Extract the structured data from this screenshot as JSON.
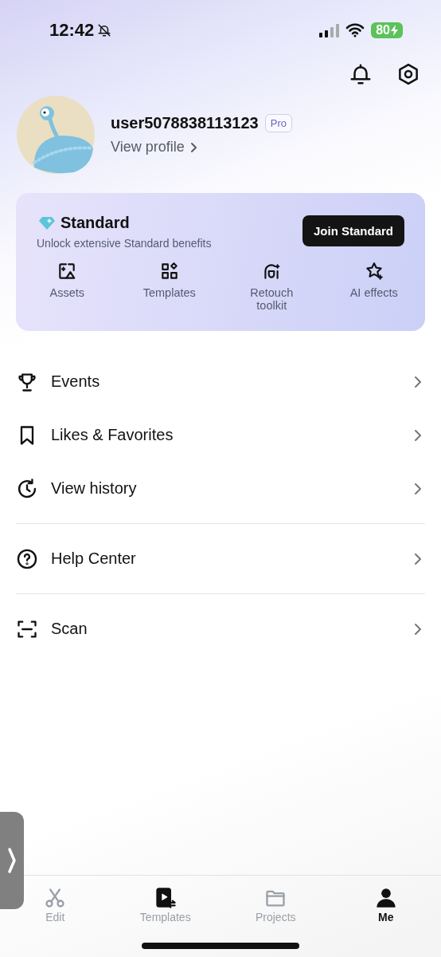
{
  "status_bar": {
    "time": "12:42",
    "silent": true,
    "battery": "80",
    "charging": true
  },
  "header_actions": [
    {
      "kind": "bell"
    },
    {
      "kind": "settings"
    }
  ],
  "profile": {
    "username": "user5078838113123",
    "badge": "Pro",
    "link": "View profile"
  },
  "membership": {
    "title": "Standard",
    "subtitle": "Unlock extensive Standard benefits",
    "button": "Join Standard",
    "benefits": [
      {
        "kind": "assets",
        "label": "Assets"
      },
      {
        "kind": "templates",
        "label": "Templates"
      },
      {
        "kind": "retouch",
        "label": "Retouch toolkit"
      },
      {
        "kind": "ai",
        "label": "AI effects"
      }
    ]
  },
  "menu_groups": [
    [
      {
        "kind": "trophy",
        "label": "Events"
      },
      {
        "kind": "bookmark",
        "label": "Likes & Favorites"
      },
      {
        "kind": "history",
        "label": "View history"
      }
    ],
    [
      {
        "kind": "help",
        "label": "Help Center"
      }
    ],
    [
      {
        "kind": "scan",
        "label": "Scan"
      }
    ]
  ],
  "tab_bar": [
    {
      "kind": "edit",
      "label": "Edit",
      "selected": false
    },
    {
      "kind": "templates",
      "label": "Templates",
      "selected": false
    },
    {
      "kind": "projects",
      "label": "Projects",
      "selected": false
    },
    {
      "kind": "me",
      "label": "Me",
      "selected": true
    }
  ]
}
